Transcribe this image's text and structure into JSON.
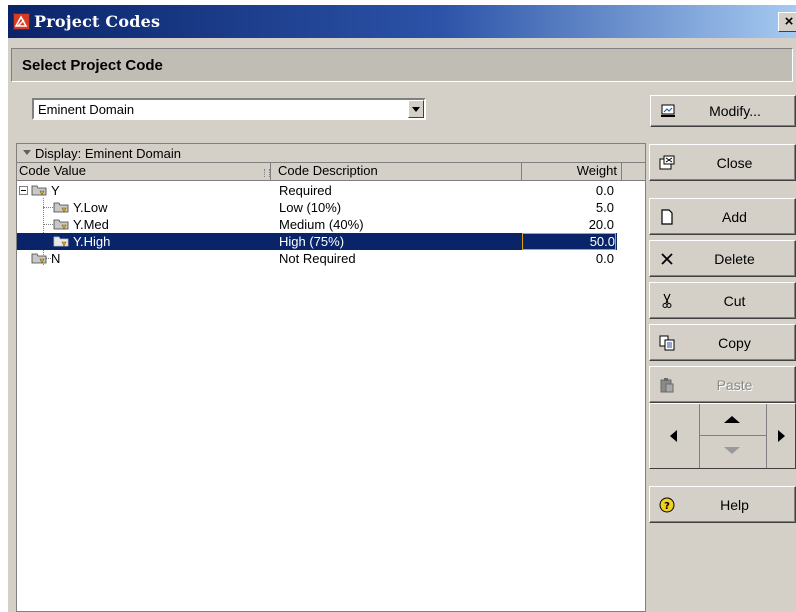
{
  "window": {
    "title": "Project Codes",
    "close_glyph": "×"
  },
  "section": {
    "title": "Select Project Code"
  },
  "combo": {
    "selected": "Eminent Domain"
  },
  "buttons": {
    "modify": "Modify...",
    "close": "Close",
    "add": "Add",
    "delete": "Delete",
    "cut": "Cut",
    "copy": "Copy",
    "paste": "Paste",
    "help": "Help"
  },
  "grid": {
    "group_label": "Display: Eminent Domain",
    "columns": {
      "code_value": "Code Value",
      "code_description": "Code Description",
      "weight": "Weight"
    },
    "rows": [
      {
        "code": "Y",
        "description": "Required",
        "weight": "0.0"
      },
      {
        "code": "Y.Low",
        "description": "Low (10%)",
        "weight": "5.0"
      },
      {
        "code": "Y.Med",
        "description": "Medium (40%)",
        "weight": "20.0"
      },
      {
        "code": "Y.High",
        "description": "High (75%)",
        "weight": "50.0"
      },
      {
        "code": "N",
        "description": "Not Required",
        "weight": "0.0"
      }
    ]
  },
  "icons": {
    "app": "project-codes-app-icon",
    "folder": "code-folder-icon",
    "modify": "modify-icon",
    "close": "close-window-icon",
    "add": "new-document-icon",
    "delete": "delete-x-icon",
    "cut": "scissors-icon",
    "copy": "copy-icon",
    "paste": "paste-icon",
    "help": "help-question-icon"
  },
  "colors": {
    "selection": "#0a246a",
    "title_bar_start": "#0a246a",
    "title_bar_end": "#a6caf0",
    "weight_focus_border": "#d9a300"
  }
}
